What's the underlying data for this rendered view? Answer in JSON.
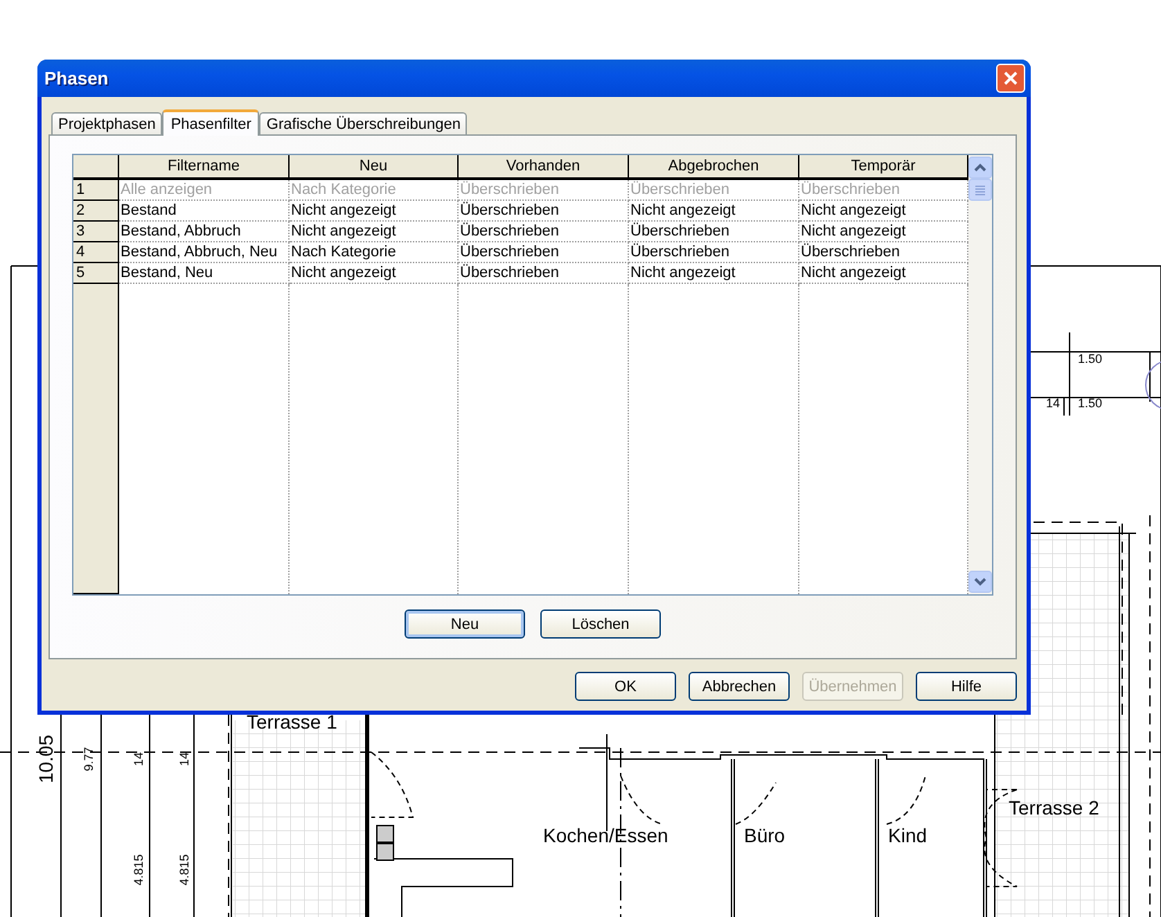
{
  "plan": {
    "labels": [
      {
        "text": "1.50",
        "kind": "dimension"
      },
      {
        "text": "14",
        "kind": "dimension"
      },
      {
        "text": "1.50",
        "kind": "dimension"
      },
      {
        "text": "Terrasse 1",
        "kind": "room"
      },
      {
        "text": "10.05",
        "kind": "dimension"
      },
      {
        "text": "9.77",
        "kind": "dimension"
      },
      {
        "text": "14",
        "kind": "dimension"
      },
      {
        "text": "14",
        "kind": "dimension"
      },
      {
        "text": "Terrasse 2",
        "kind": "room"
      },
      {
        "text": "Kochen/Essen",
        "kind": "room"
      },
      {
        "text": "Büro",
        "kind": "room"
      },
      {
        "text": "Kind",
        "kind": "room"
      },
      {
        "text": "4.815",
        "kind": "dimension"
      },
      {
        "text": "4.815",
        "kind": "dimension"
      }
    ]
  },
  "dialog": {
    "title": "Phasen",
    "tabs": [
      {
        "label": "Projektphasen",
        "selected": false
      },
      {
        "label": "Phasenfilter",
        "selected": true
      },
      {
        "label": "Grafische Überschreibungen",
        "selected": false
      }
    ],
    "grid": {
      "columns": [
        "Filtername",
        "Neu",
        "Vorhanden",
        "Abgebrochen",
        "Temporär"
      ],
      "rows": [
        {
          "number": "1",
          "disabled": true,
          "cells": [
            "Alle anzeigen",
            "Nach Kategorie",
            "Überschrieben",
            "Überschrieben",
            "Überschrieben"
          ]
        },
        {
          "number": "2",
          "disabled": false,
          "cells": [
            "Bestand",
            "Nicht angezeigt",
            "Überschrieben",
            "Nicht angezeigt",
            "Nicht angezeigt"
          ]
        },
        {
          "number": "3",
          "disabled": false,
          "cells": [
            "Bestand, Abbruch",
            "Nicht angezeigt",
            "Überschrieben",
            "Überschrieben",
            "Nicht angezeigt"
          ]
        },
        {
          "number": "4",
          "disabled": false,
          "cells": [
            "Bestand, Abbruch, Neu",
            "Nach Kategorie",
            "Überschrieben",
            "Überschrieben",
            "Überschrieben"
          ]
        },
        {
          "number": "5",
          "disabled": false,
          "cells": [
            "Bestand, Neu",
            "Nicht angezeigt",
            "Überschrieben",
            "Nicht angezeigt",
            "Nicht angezeigt"
          ]
        }
      ]
    },
    "grid_buttons": [
      {
        "label": "Neu",
        "focused": true
      },
      {
        "label": "Löschen",
        "focused": false
      }
    ],
    "buttons": [
      {
        "label": "OK",
        "disabled": false
      },
      {
        "label": "Abbrechen",
        "disabled": false
      },
      {
        "label": "Übernehmen",
        "disabled": true
      },
      {
        "label": "Hilfe",
        "disabled": false
      }
    ]
  }
}
